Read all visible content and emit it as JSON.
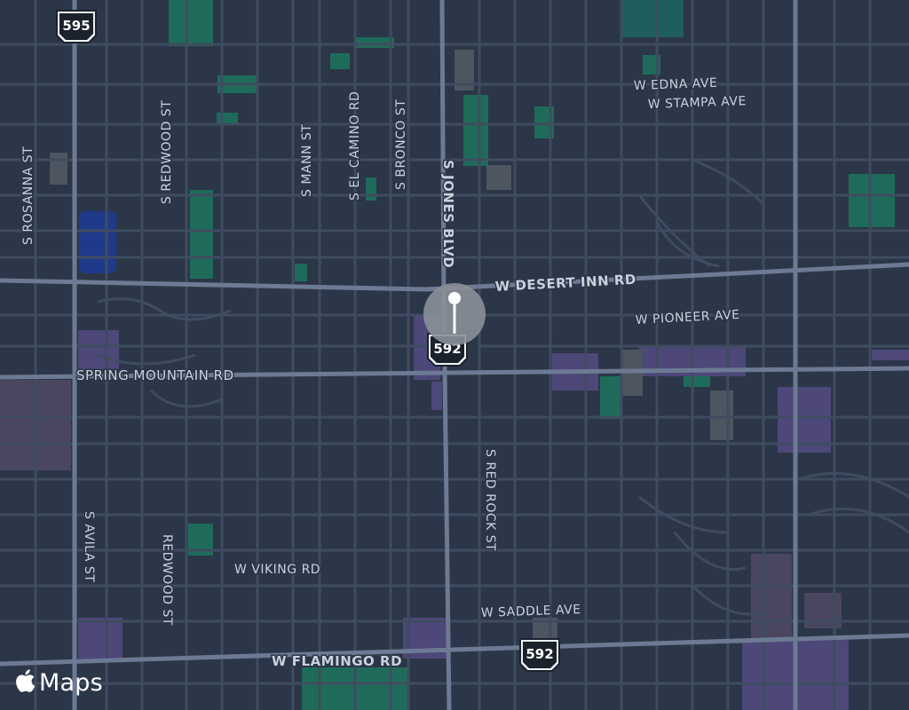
{
  "map": {
    "attribution": {
      "logo": "apple-icon",
      "text": "Maps"
    },
    "pin": {
      "icon": "map-pin-icon"
    },
    "highway_shields": [
      "595",
      "592",
      "592"
    ],
    "street_labels": [
      "S ROSANNA ST",
      "S REDWOOD ST",
      "S MANN ST",
      "S EL CAMINO RD",
      "S BRONCO ST",
      "S JONES BLVD",
      "W EDNA AVE",
      "W STAMPA AVE",
      "W DESERT INN RD",
      "W PIONEER AVE",
      "SPRING MOUNTAIN RD",
      "S RED ROCK ST",
      "S AVILA ST",
      "REDWOOD ST",
      "W VIKING RD",
      "W SADDLE AVE",
      "W FLAMINGO RD"
    ],
    "colors": {
      "background": "#2b3648",
      "street": "#3f4c60",
      "arterial": "#6c7a93",
      "label": "#c9d2dd",
      "park": "#1f6b5a",
      "water": "#1f3a8a",
      "commercial": "#4e4779",
      "industrial": "#4a4660",
      "pin_bubble": "#8b9099"
    }
  }
}
